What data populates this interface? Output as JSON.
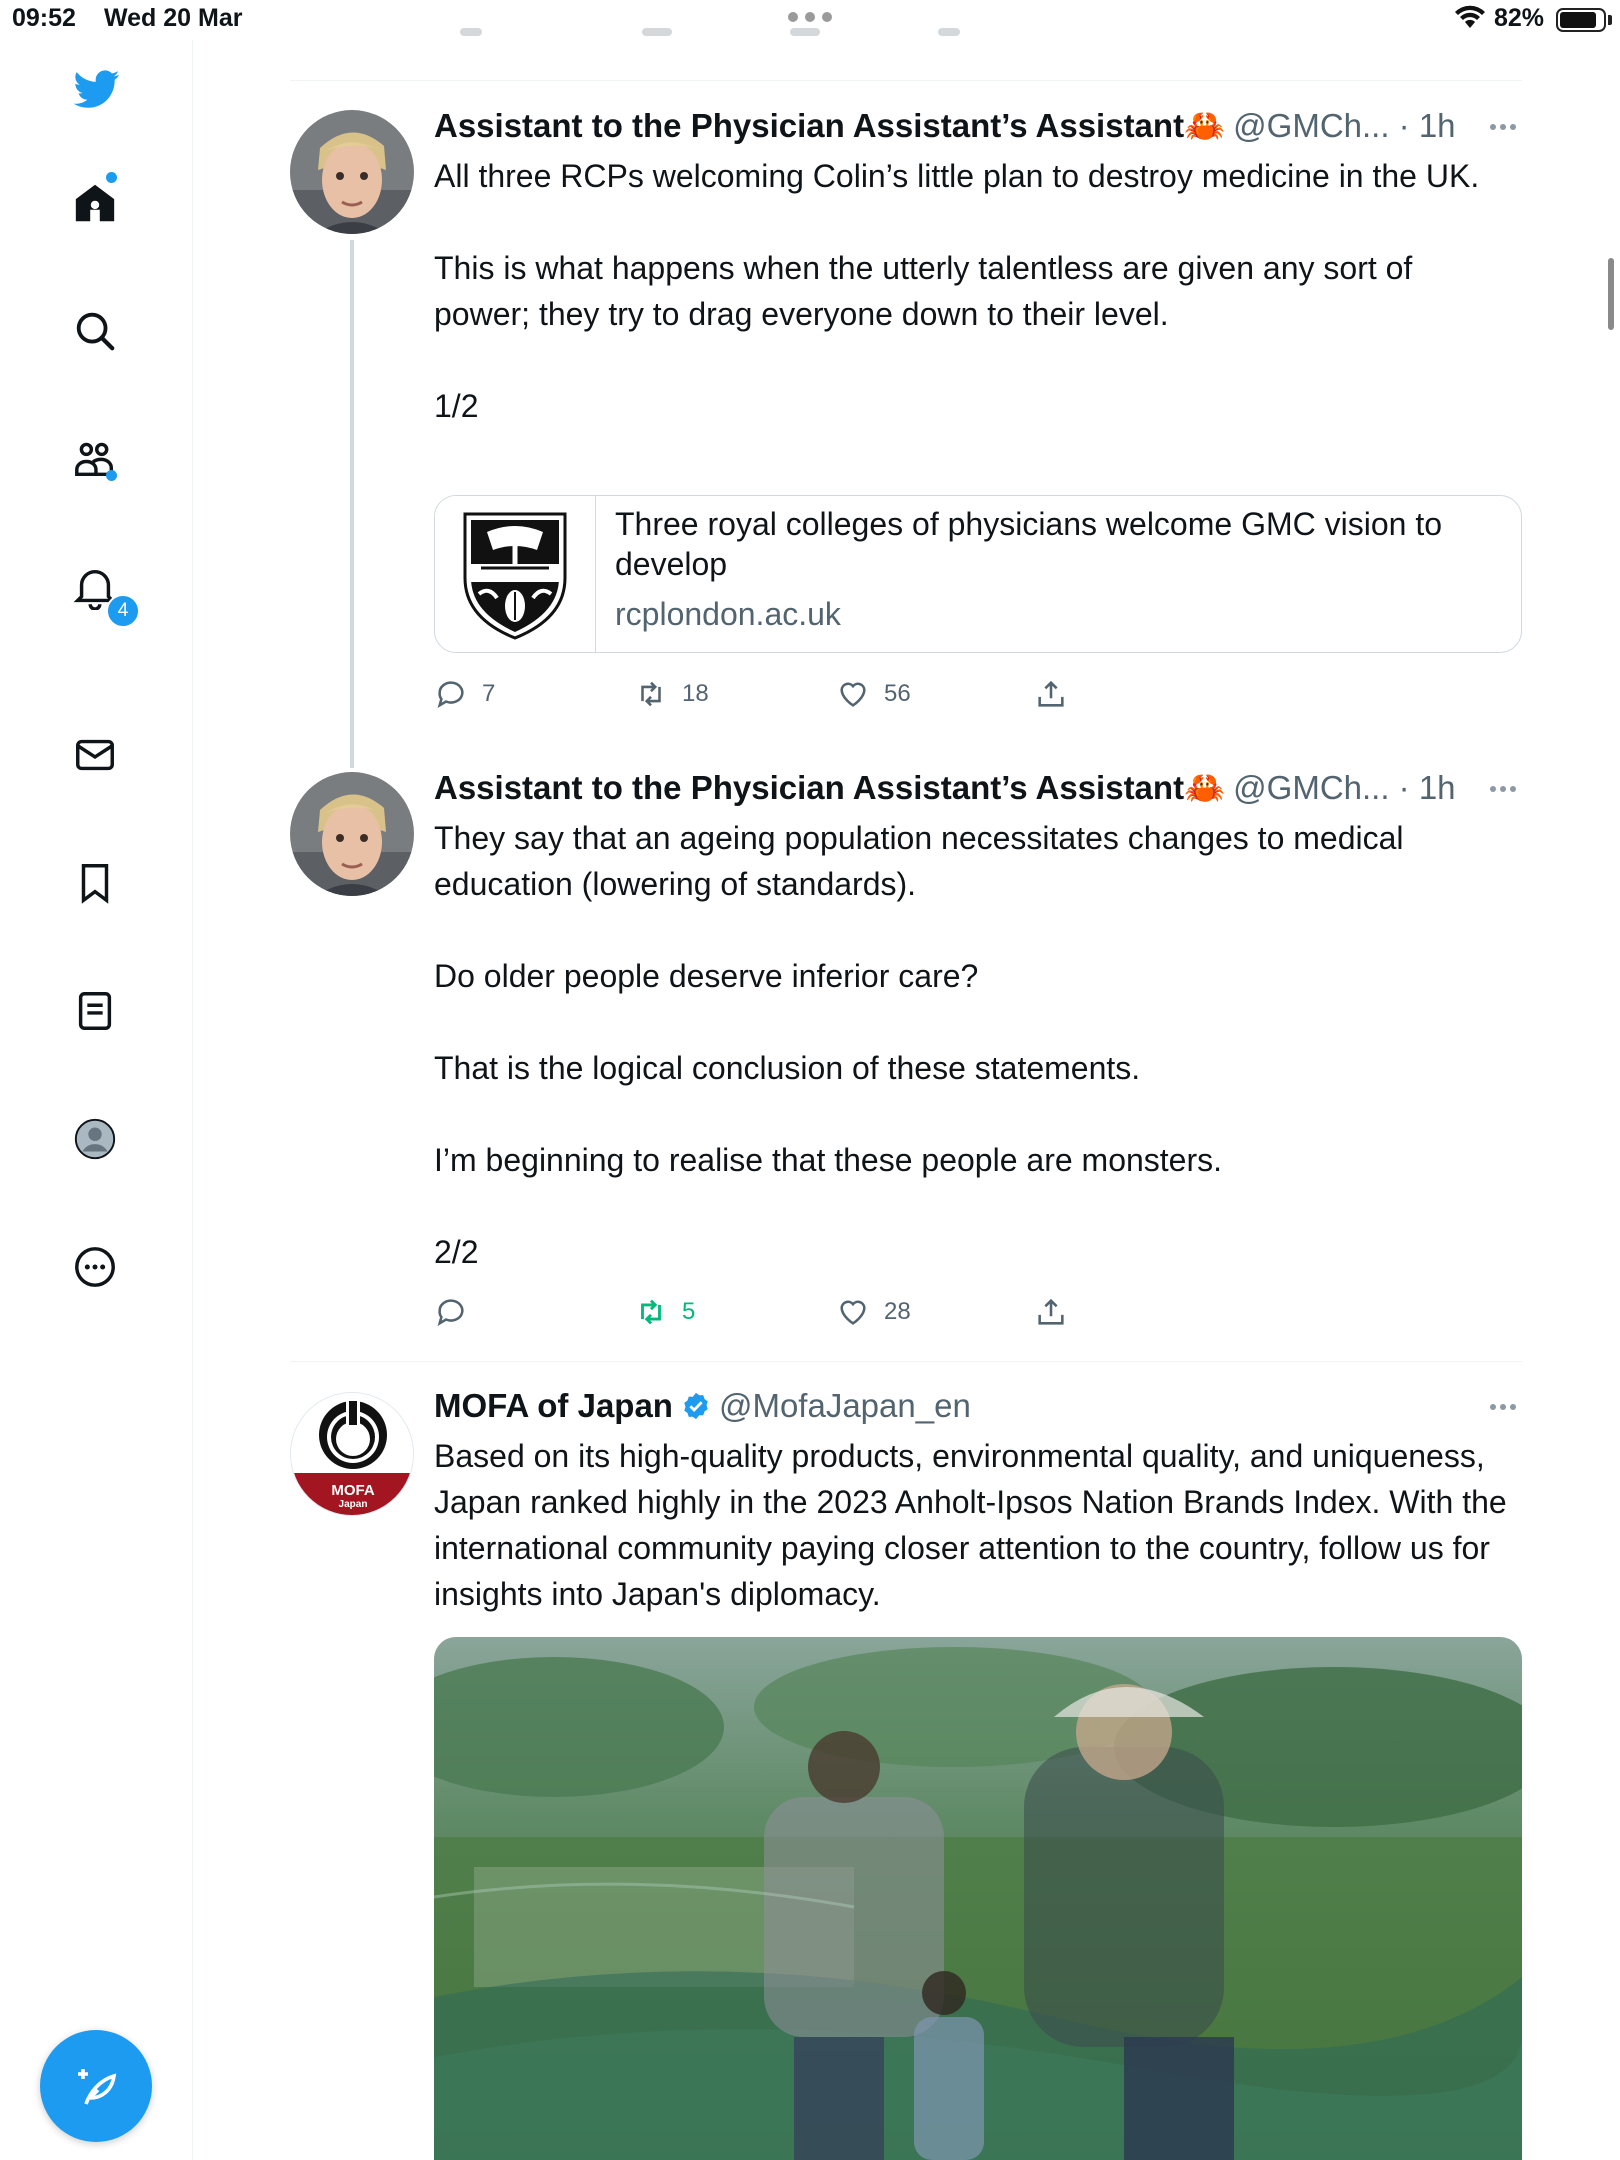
{
  "status_bar": {
    "time": "09:52",
    "date": "Wed 20 Mar",
    "battery": "82%"
  },
  "sidebar": {
    "items": [
      {
        "name": "home",
        "icon": "home-icon"
      },
      {
        "name": "search",
        "icon": "search-icon"
      },
      {
        "name": "communities",
        "icon": "communities-icon"
      },
      {
        "name": "notifications",
        "icon": "bell-icon",
        "badge": "4"
      },
      {
        "name": "messages",
        "icon": "mail-icon"
      },
      {
        "name": "bookmarks",
        "icon": "bookmark-icon"
      },
      {
        "name": "lists",
        "icon": "list-icon"
      },
      {
        "name": "profile",
        "icon": "profile-icon"
      },
      {
        "name": "more",
        "icon": "more-circle-icon"
      }
    ],
    "accent": "#1d9bf0"
  },
  "tweets": [
    {
      "name": "Assistant to the Physician Assistant’s Assistant",
      "emoji": "🦀",
      "handle": "@GMCh... · 1h",
      "text": "All three RCPs welcoming Colin’s little plan to destroy medicine in the UK.\n\nThis is what happens when the utterly talentless are given any sort of power; they try to drag everyone down to their level.\n\n1/2",
      "card": {
        "title": "Three royal colleges of physicians welcome GMC vision to develop",
        "domain": "rcplondon.ac.uk"
      },
      "actions": {
        "replies": "7",
        "retweets": "18",
        "likes": "56"
      }
    },
    {
      "name": "Assistant to the Physician Assistant’s Assistant",
      "emoji": "🦀",
      "handle": "@GMCh... · 1h",
      "text": "They say that an ageing population necessitates changes to medical education (lowering of standards).\n\nDo older people deserve inferior care?\n\nThat is the logical conclusion of these statements.\n\nI’m beginning to realise that these people are monsters.\n\n2/2",
      "actions": {
        "replies": "",
        "retweets": "5",
        "likes": "28"
      }
    },
    {
      "name": "MOFA of Japan",
      "verified": true,
      "handle": "@MofaJapan_en",
      "avatar_text": {
        "line1": "MOFA",
        "line2": "Japan"
      },
      "text": "Based on its high-quality products, environmental quality, and uniqueness, Japan ranked highly in the 2023 Anholt-Ipsos Nation Brands Index. With the international community paying closer attention to the country, follow us for insights into Japan's diplomacy."
    }
  ]
}
